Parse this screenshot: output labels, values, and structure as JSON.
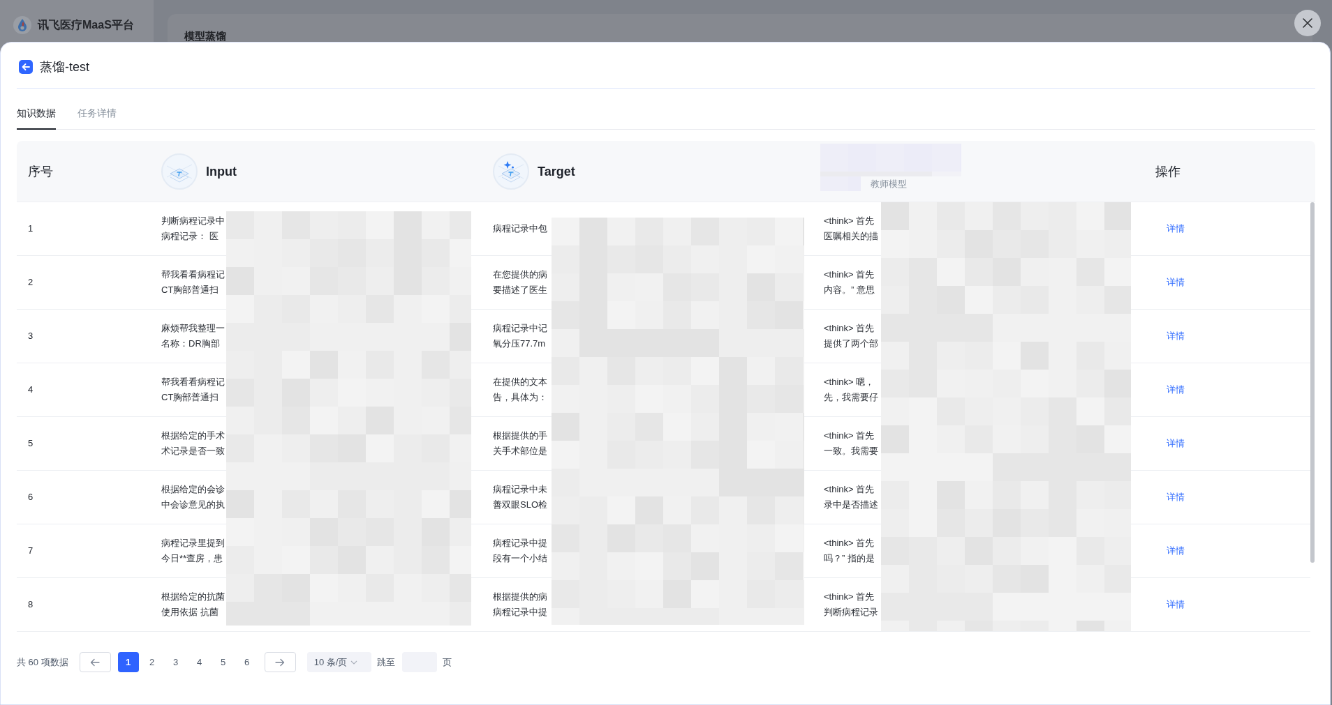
{
  "app": {
    "brand": "讯飞医疗MaaS平台",
    "page_title": "模型蒸馏"
  },
  "dialog": {
    "title": "蒸馏-test",
    "tabs": [
      {
        "label": "知识数据",
        "selected": true
      },
      {
        "label": "任务详情",
        "selected": false
      }
    ],
    "table": {
      "columns": [
        {
          "label": "序号",
          "kind": "plain"
        },
        {
          "label": "Input",
          "kind": "layers"
        },
        {
          "label": "Target",
          "kind": "layers_sparkle"
        },
        {
          "label": "教师模型",
          "kind": "masked"
        },
        {
          "label": "操作",
          "kind": "plain"
        }
      ],
      "rows": [
        {
          "index": "1",
          "input": [
            "判断病程记录中",
            "病程记录： 医"
          ],
          "target": [
            "病程记录中包"
          ],
          "teacher_model": [
            "<think> 首先",
            "医嘱相关的描"
          ],
          "action": "详情"
        },
        {
          "index": "2",
          "input": [
            "帮我看看病程记",
            "CT胸部普通扫"
          ],
          "target": [
            "在您提供的病",
            "要描述了医生"
          ],
          "teacher_model": [
            "<think> 首先",
            "内容。” 意思"
          ],
          "action": "详情"
        },
        {
          "index": "3",
          "input": [
            "麻烦帮我整理一",
            "名称：DR胸部"
          ],
          "target": [
            "病程记录中记",
            "氧分压77.7m"
          ],
          "teacher_model": [
            "<think> 首先",
            "提供了两个部"
          ],
          "action": "详情"
        },
        {
          "index": "4",
          "input": [
            "帮我看看病程记",
            "CT胸部普通扫"
          ],
          "target": [
            "在提供的文本",
            "告，具体为："
          ],
          "teacher_model": [
            "<think> 嗯，",
            "先，我需要仔"
          ],
          "action": "详情"
        },
        {
          "index": "5",
          "input": [
            "根据给定的手术",
            "术记录是否一致"
          ],
          "target": [
            "根据提供的手",
            "关手术部位是"
          ],
          "teacher_model": [
            "<think> 首先",
            "一致。我需要"
          ],
          "action": "详情"
        },
        {
          "index": "6",
          "input": [
            "根据给定的会诊",
            "中会诊意见的执"
          ],
          "target": [
            "病程记录中未",
            "善双眼SLO检"
          ],
          "teacher_model": [
            "<think> 首先",
            "录中是否描述"
          ],
          "action": "详情"
        },
        {
          "index": "7",
          "input": [
            "病程记录里提到",
            "今日**查房，患"
          ],
          "target": [
            "病程记录中提",
            "段有一个小结"
          ],
          "teacher_model": [
            "<think> 首先",
            "吗？” 指的是"
          ],
          "action": "详情"
        },
        {
          "index": "8",
          "input": [
            "根据给定的抗菌",
            "使用依据 抗菌"
          ],
          "target": [
            "根据提供的病",
            "病程记录中提"
          ],
          "teacher_model": [
            "<think> 首先",
            "判断病程记录"
          ],
          "action": "详情"
        }
      ]
    },
    "pagination": {
      "total": "共 60 项数据",
      "pages": [
        {
          "label": "1",
          "selected": true
        },
        {
          "label": "2",
          "selected": false
        },
        {
          "label": "3",
          "selected": false
        },
        {
          "label": "4",
          "selected": false
        },
        {
          "label": "5",
          "selected": false
        },
        {
          "label": "6",
          "selected": false
        }
      ],
      "page_size": "10 条/页",
      "jump_label": "跳至",
      "jump_suffix": "页"
    }
  }
}
